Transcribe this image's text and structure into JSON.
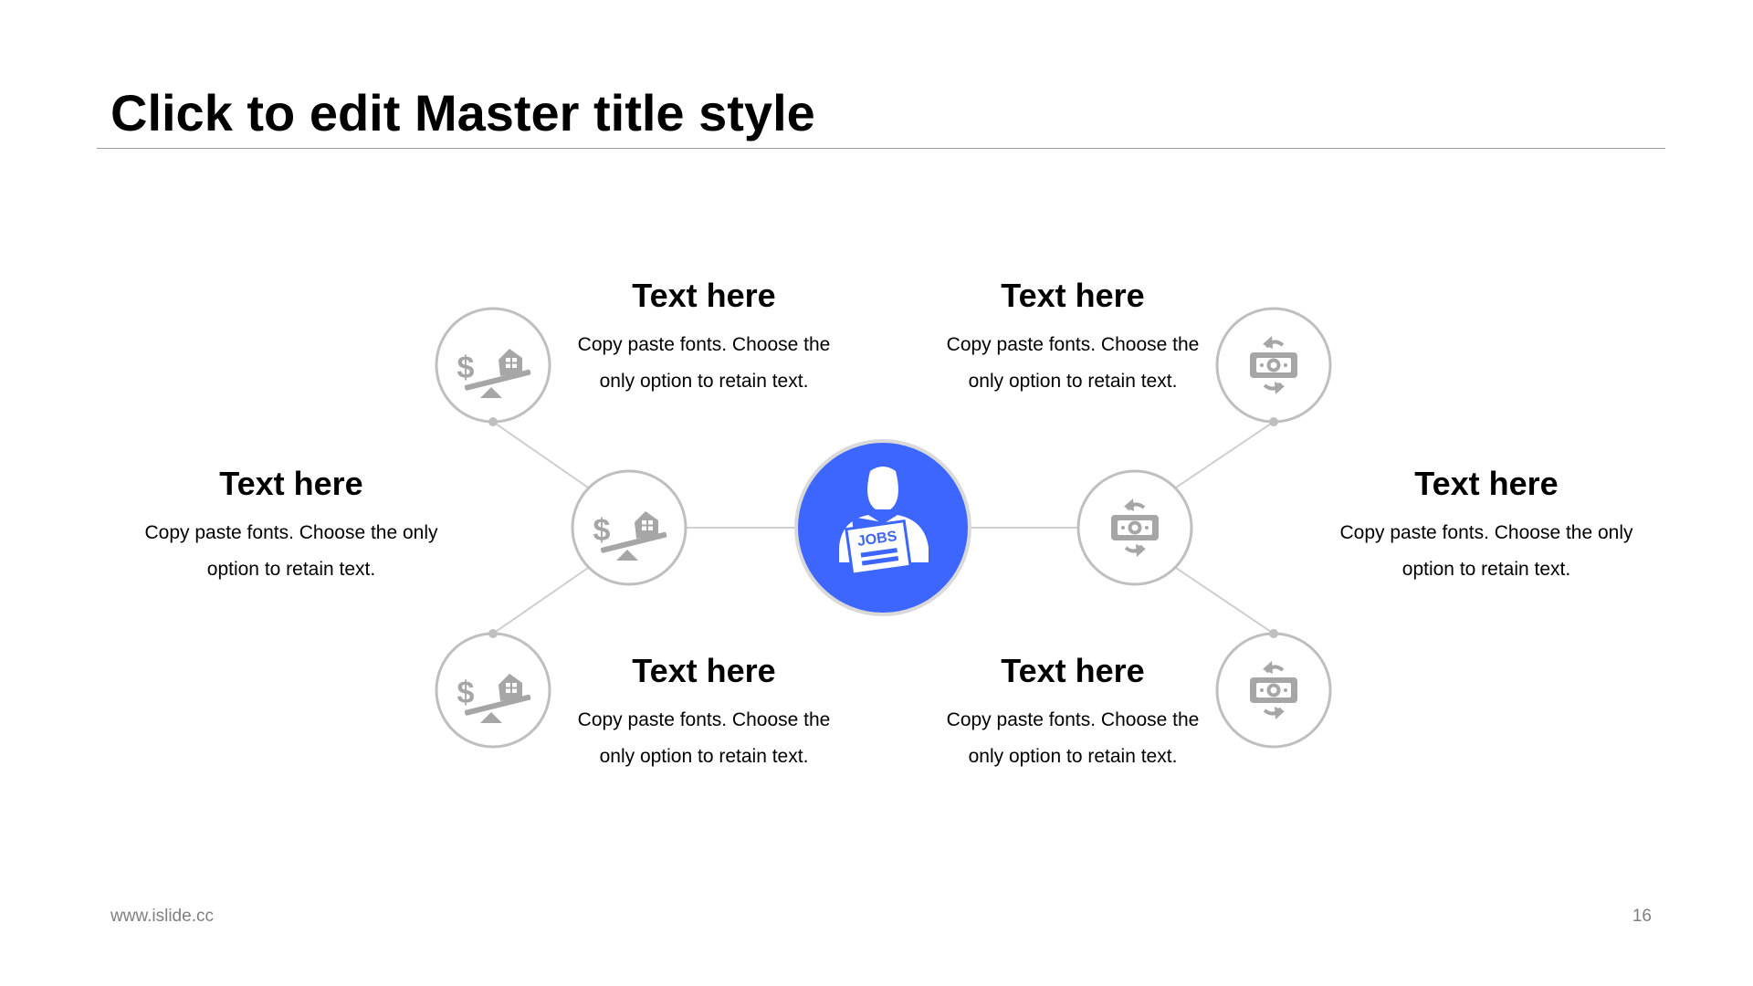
{
  "slide": {
    "title": "Click to edit Master title style",
    "footer_url": "www.islide.cc",
    "page_number": "16"
  },
  "colors": {
    "accent": "#3d66ff",
    "circle_stroke": "#bfbfbf",
    "icon_gray": "#a6a6a6",
    "connector": "#cfcfcf"
  },
  "center_node": {
    "icon": "jobs-person-icon",
    "icon_text": "JOBS"
  },
  "nodes": [
    {
      "icon": "seesaw-house-dollar-icon"
    },
    {
      "icon": "seesaw-house-dollar-icon"
    },
    {
      "icon": "seesaw-house-dollar-icon"
    },
    {
      "icon": "cash-exchange-icon"
    },
    {
      "icon": "cash-exchange-icon"
    },
    {
      "icon": "cash-exchange-icon"
    }
  ],
  "text_blocks": [
    {
      "heading": "Text here",
      "body": "Copy paste fonts. Choose the only option to retain text."
    },
    {
      "heading": "Text here",
      "body": "Copy paste fonts. Choose the only option to retain text."
    },
    {
      "heading": "Text here",
      "body": "Copy paste fonts. Choose the only option to retain text."
    },
    {
      "heading": "Text here",
      "body": "Copy paste fonts. Choose the only option to retain text."
    },
    {
      "heading": "Text here",
      "body": "Copy paste fonts. Choose the only option to retain text."
    },
    {
      "heading": "Text here",
      "body": "Copy paste fonts. Choose the only option to retain text."
    }
  ]
}
